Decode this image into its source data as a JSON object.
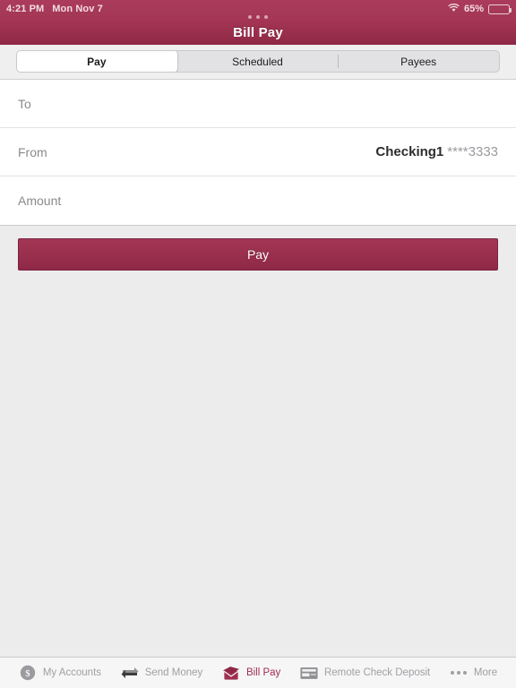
{
  "status_bar": {
    "time": "4:21 PM",
    "date": "Mon Nov 7",
    "wifi_icon": "wifi-icon",
    "battery_percent": "65%",
    "battery_level": 65,
    "battery_icon": "battery-icon"
  },
  "nav": {
    "title": "Bill Pay",
    "page_dots": 3
  },
  "segmented": {
    "selected_index": 0,
    "items": [
      {
        "label": "Pay"
      },
      {
        "label": "Scheduled"
      },
      {
        "label": "Payees"
      }
    ]
  },
  "form": {
    "rows": [
      {
        "label": "To",
        "value_main": "",
        "value_sub": ""
      },
      {
        "label": "From",
        "value_main": "Checking1",
        "value_sub": "****3333"
      },
      {
        "label": "Amount",
        "value_main": "",
        "value_sub": ""
      }
    ]
  },
  "actions": {
    "pay_label": "Pay"
  },
  "tabbar": {
    "active_index": 2,
    "items": [
      {
        "label": "My Accounts",
        "icon": "dollar-circle-icon"
      },
      {
        "label": "Send Money",
        "icon": "transfer-arrows-icon"
      },
      {
        "label": "Bill Pay",
        "icon": "envelope-icon"
      },
      {
        "label": "Remote Check Deposit",
        "icon": "check-document-icon"
      },
      {
        "label": "More",
        "icon": "ellipsis-icon"
      }
    ]
  },
  "colors": {
    "brand": "#9e2f4f",
    "brand_dark": "#8e2846",
    "brand_light": "#a63755",
    "page_bg": "#ececec",
    "muted_text": "#8a8a8f"
  }
}
